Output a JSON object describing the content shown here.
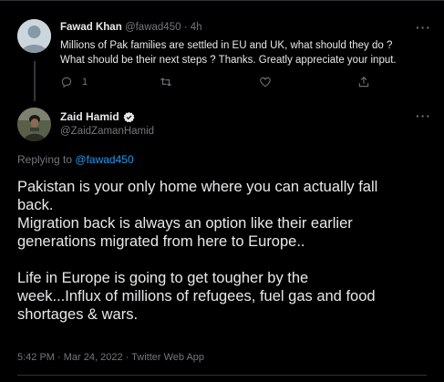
{
  "parent_tweet": {
    "display_name": "Fawad Khan",
    "handle": "@fawad450",
    "separator": "·",
    "time": "4h",
    "text_line1": "Millions of Pak families are settled in EU and UK, what should they do ?",
    "text_line2": "What should be their next steps ? Thanks. Greatly appreciate your input.",
    "reply_count": "1",
    "more_label": "···"
  },
  "main_tweet": {
    "display_name": "Zaid Hamid",
    "handle": "@ZaidZamanHamid",
    "more_label": "···",
    "replying_prefix": "Replying to",
    "replying_handle": "@fawad450",
    "body_line1": "Pakistan is your only home where you can actually fall",
    "body_line2": "back.",
    "body_line3": "Migration back is always an option like their earlier",
    "body_line4": "generations migrated from here to Europe..",
    "body_line5": "Life in Europe is going to get tougher by the",
    "body_line6": "week...Influx of millions of refugees, fuel gas and food",
    "body_line7": "shortages & wars.",
    "timestamp": "5:42 PM · Mar 24, 2022 · Twitter Web App"
  },
  "icons": [
    "reply-icon",
    "retweet-icon",
    "like-icon",
    "share-icon",
    "verified-badge-icon"
  ],
  "colors": {
    "background": "#000000",
    "text": "#e7e9ea",
    "muted": "#71767b",
    "link": "#1d9bf0",
    "separator": "#2f3336"
  }
}
